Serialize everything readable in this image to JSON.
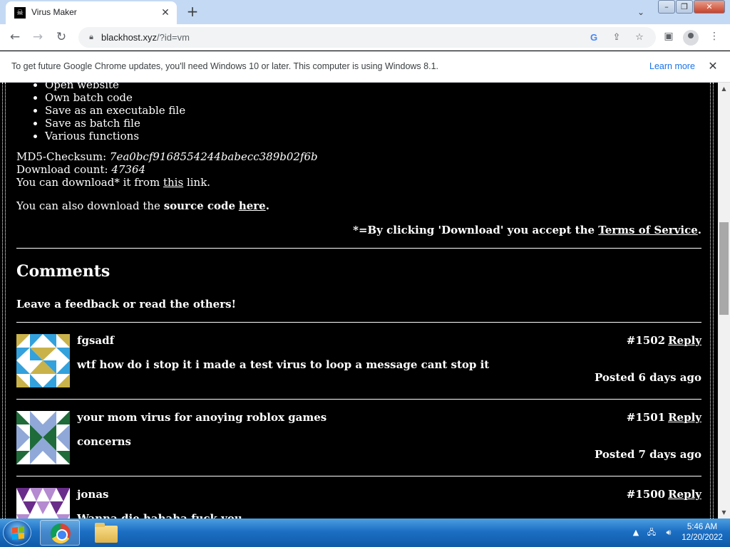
{
  "browser": {
    "tab_title": "Virus Maker",
    "url_host": "blackhost.xyz",
    "url_path": "/?id=vm"
  },
  "infobar": {
    "message": "To get future Google Chrome updates, you'll need Windows 10 or later. This computer is using Windows 8.1.",
    "link": "Learn more"
  },
  "content": {
    "features": [
      "Open website",
      "Own batch code",
      "Save as an executable file",
      "Save as batch file",
      "Various functions"
    ],
    "md5_label": "MD5-Checksum:",
    "md5_value": "7ea0bcf9168554244babecc389b02f6b",
    "download_label": "Download count:",
    "download_count": "47364",
    "download_pre": "You can download* it from",
    "download_link": "this",
    "download_post": "link.",
    "source_pre": "You can also download the",
    "source_bold": "source code",
    "source_link": "here",
    "tos_pre": "*=By clicking 'Download' you accept the",
    "tos_link": "Terms of Service",
    "comments_title": "Comments",
    "comments_sub": "Leave a feedback or read the others!",
    "reply_label": "Reply",
    "comments": [
      {
        "author": "fgsadf",
        "number": "#1502",
        "text": "wtf how do i stop it i made a test virus to loop a message cant stop it",
        "posted": "Posted 6 days ago"
      },
      {
        "author": "your mom virus for anoying roblox games",
        "number": "#1501",
        "text": "concerns",
        "posted": "Posted 7 days ago"
      },
      {
        "author": "jonas",
        "number": "#1500",
        "text": "Wanna die hahaha fuck you",
        "posted": ""
      }
    ]
  },
  "taskbar": {
    "time": "5:46 AM",
    "date": "12/20/2022"
  },
  "colors": {
    "page_bg": "#000000",
    "tabstrip_bg": "#c4d9f3",
    "link_blue": "#1a73e8"
  }
}
